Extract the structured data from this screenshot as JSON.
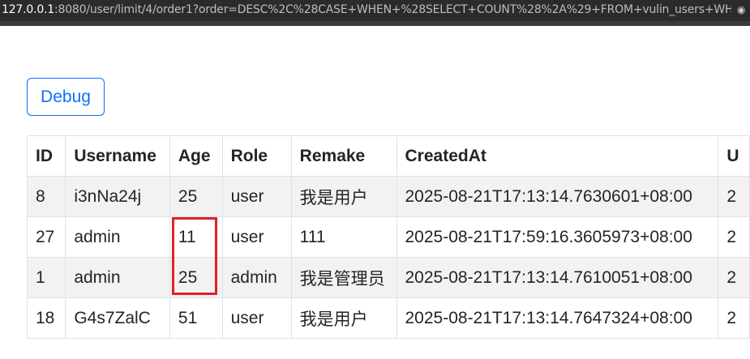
{
  "browser": {
    "url_host": "127.0.0.1",
    "url_rest": ":8080/user/limit/4/order1?order=DESC%2C%28CASE+WHEN+%28SELECT+COUNT%28%2A%29+FROM+vulin_users+WHE..."
  },
  "toolbar": {
    "debug_label": "Debug"
  },
  "table": {
    "headers": [
      "ID",
      "Username",
      "Age",
      "Role",
      "Remake",
      "CreatedAt",
      "U"
    ],
    "rows": [
      [
        "8",
        "i3nNa24j",
        "25",
        "user",
        "我是用户",
        "2025-08-21T17:13:14.7630601+08:00",
        "2"
      ],
      [
        "27",
        "admin",
        "11",
        "user",
        "111",
        "2025-08-21T17:59:16.3605973+08:00",
        "2"
      ],
      [
        "1",
        "admin",
        "25",
        "admin",
        "我是管理员",
        "2025-08-21T17:13:14.7610051+08:00",
        "2"
      ],
      [
        "18",
        "G4s7ZalC",
        "51",
        "user",
        "我是用户",
        "2025-08-21T17:13:14.7647324+08:00",
        "2"
      ]
    ]
  },
  "colors": {
    "accent": "#0d6efd",
    "highlight": "#e0202a",
    "stripe": "#f2f2f2"
  }
}
